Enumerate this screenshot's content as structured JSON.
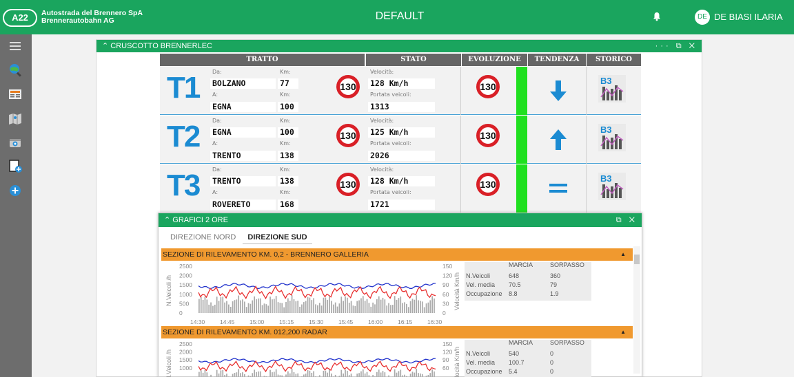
{
  "header": {
    "logo": "A22",
    "company_line1": "Autostrada del Brennero SpA",
    "company_line2": "Brennerautobahn AG",
    "title": "DEFAULT",
    "user_initials": "DE",
    "user_name": "DE BIASI ILARIA"
  },
  "dashboard": {
    "title": "CRUSCOTTO BRENNERLEC",
    "tools": "··· ⧉ ✕",
    "columns": [
      "TRATTO",
      "STATO",
      "EVOLUZIONE",
      "TENDENZA",
      "STORICO"
    ],
    "labels": {
      "da": "Da:",
      "a": "A:",
      "km": "Km:",
      "velocita": "Velocità:",
      "portata": "Portata veicoli:"
    },
    "rows": [
      {
        "code": "T1",
        "from": "BOLZANO",
        "from_km": "77",
        "to": "EGNA",
        "to_km": "100",
        "speed_limit": "130",
        "speed": "128 Km/h",
        "flow": "1313",
        "evolution_limit": "130",
        "trend": "down",
        "storico": "B3"
      },
      {
        "code": "T2",
        "from": "EGNA",
        "from_km": "100",
        "to": "TRENTO",
        "to_km": "138",
        "speed_limit": "130",
        "speed": "125 Km/h",
        "flow": "2026",
        "evolution_limit": "130",
        "trend": "up",
        "storico": "B3"
      },
      {
        "code": "T3",
        "from": "TRENTO",
        "from_km": "138",
        "to": "ROVERETO",
        "to_km": "168",
        "speed_limit": "130",
        "speed": "128 Km/h",
        "flow": "1721",
        "evolution_limit": "130",
        "trend": "equal",
        "storico": "B3"
      }
    ]
  },
  "grafici": {
    "title": "GRAFICI 2 ORE",
    "tools": "⧉ ✕",
    "tabs": [
      "DIREZIONE NORD",
      "DIREZIONE SUD"
    ],
    "active_tab": "DIREZIONE SUD",
    "sections": [
      {
        "title": "SEZIONE DI RILEVAMENTO KM. 0,2 - BRENNERO GALLERIA",
        "y_left_label": "N.Veicoli /h",
        "y_right_label": "Velocità Km/h",
        "y_left_ticks": [
          "2500",
          "2000",
          "1500",
          "1000",
          "500",
          "0"
        ],
        "y_right_ticks": [
          "150",
          "120",
          "90",
          "60",
          "30",
          "0"
        ],
        "x_ticks": [
          "14:30",
          "14:45",
          "15:00",
          "15:15",
          "15:30",
          "15:45",
          "16:00",
          "16:15",
          "16:30"
        ],
        "stats_cols": [
          "MARCIA",
          "SORPASSO"
        ],
        "stats": [
          {
            "label": "N.Veicoli",
            "marcia": "648",
            "sorpasso": "360"
          },
          {
            "label": "Vel. media",
            "marcia": "70.5",
            "sorpasso": "79"
          },
          {
            "label": "Occupazione",
            "marcia": "8.8",
            "sorpasso": "1.9"
          }
        ]
      },
      {
        "title": "SEZIONE DI RILEVAMENTO KM. 012,200 RADAR",
        "y_left_label": "N.Veicoli /h",
        "y_right_label": "Velocità Km/h",
        "y_left_ticks": [
          "2500",
          "2000",
          "1500",
          "1000"
        ],
        "y_right_ticks": [
          "150",
          "120",
          "90",
          "60"
        ],
        "stats_cols": [
          "MARCIA",
          "SORPASSO"
        ],
        "stats": [
          {
            "label": "N.Veicoli",
            "marcia": "540",
            "sorpasso": "0"
          },
          {
            "label": "Vel. media",
            "marcia": "100.7",
            "sorpasso": "0"
          },
          {
            "label": "Occupazione",
            "marcia": "5.4",
            "sorpasso": "0"
          }
        ]
      }
    ]
  },
  "colors": {
    "green": "#1aa55e",
    "orange": "#f0992f",
    "blue_series": "#2233cc",
    "red_series": "#e83030",
    "bars": "#aaaaaa"
  }
}
